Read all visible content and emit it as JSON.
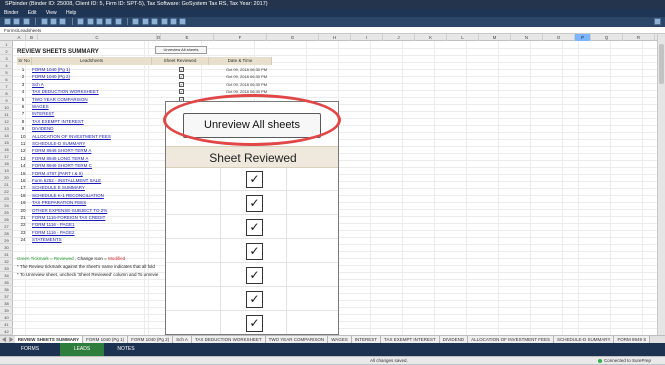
{
  "window": {
    "title": "SPbinder (Binder ID: 25008, Client ID: 5, Firm ID: SPT-5), Tax Software: GoSystem Tax RS, Tax Year: 2017)"
  },
  "menu": [
    "Binder",
    "Edit",
    "View",
    "Help"
  ],
  "breadcrumb": "Forms\\Leadsheets",
  "columns": [
    "A",
    "B",
    "C",
    "D",
    "E",
    "F",
    "G",
    "H",
    "I",
    "J",
    "K",
    "L",
    "M",
    "N",
    "O",
    "P",
    "Q",
    "R",
    "S",
    "T"
  ],
  "active_column": "P",
  "row_numbers": [
    "1",
    "2",
    "3",
    "4",
    "5",
    "6",
    "7",
    "8",
    "9",
    "10",
    "11",
    "12",
    "13",
    "14",
    "15",
    "16",
    "17",
    "18",
    "19",
    "20",
    "21",
    "22",
    "23",
    "24",
    "25",
    "26",
    "27",
    "28",
    "29",
    "30",
    "31",
    "32",
    "33",
    "34",
    "35",
    "36",
    "37",
    "38",
    "39",
    "40",
    "41",
    "42"
  ],
  "sheet": {
    "title": "REVIEW SHEETS SUMMARY",
    "headers": {
      "srno": "Sr No",
      "leadsheets": "Leadsheets",
      "reviewed": "Sheet Reviewed",
      "datetime": "Date & Time"
    },
    "unreview_button": "Unreview All sheets",
    "rows": [
      {
        "no": "1",
        "name": "FORM 1040 (Pg 1)",
        "checked": true,
        "date": "Oct 09, 2018 06:30 PM"
      },
      {
        "no": "2",
        "name": "FORM 1040 (Pg 2)",
        "checked": true,
        "date": "Oct 09, 2018 06:30 PM"
      },
      {
        "no": "3",
        "name": "Sch A",
        "checked": true,
        "date": "Oct 09, 2018 06:30 PM"
      },
      {
        "no": "4",
        "name": "TAX DEDUCTION WORKSHEET",
        "checked": true,
        "date": "Oct 09, 2018 06:30 PM"
      },
      {
        "no": "5",
        "name": "TWO YEAR COMPARISON",
        "checked": true,
        "date": ""
      },
      {
        "no": "6",
        "name": "WAGES",
        "checked": true,
        "date": ""
      },
      {
        "no": "7",
        "name": "INTEREST",
        "checked": false,
        "date": ""
      },
      {
        "no": "8",
        "name": "TAX EXEMPT INTEREST",
        "checked": false,
        "date": ""
      },
      {
        "no": "9",
        "name": "DIVIDEND",
        "checked": false,
        "date": ""
      },
      {
        "no": "10",
        "name": "ALLOCATION OF INVESTMENT FEES",
        "checked": false,
        "date": ""
      },
      {
        "no": "11",
        "name": "SCHEDULE-D SUMMARY",
        "checked": false,
        "date": ""
      },
      {
        "no": "12",
        "name": "FORM 8949 SHORT-TERM A",
        "checked": false,
        "date": ""
      },
      {
        "no": "13",
        "name": "FORM 8949 LONG TERM A",
        "checked": false,
        "date": ""
      },
      {
        "no": "14",
        "name": "FORM 8949 SHORT-TERM C",
        "checked": false,
        "date": ""
      },
      {
        "no": "15",
        "name": "FORM 4797 (PART I & II)",
        "checked": false,
        "date": ""
      },
      {
        "no": "16",
        "name": "Form 6252 - INSTALLMENT SALE",
        "checked": false,
        "date": ""
      },
      {
        "no": "17",
        "name": "SCHEDULE E SUMMARY",
        "checked": false,
        "date": ""
      },
      {
        "no": "18",
        "name": "SCHEDULE K-1 RECONCILIATION",
        "checked": false,
        "date": ""
      },
      {
        "no": "19",
        "name": "TAX PREPARATION FEES",
        "checked": false,
        "date": ""
      },
      {
        "no": "20",
        "name": "OTHER EXPENSE-SUBJECT TO 2%",
        "checked": false,
        "date": ""
      },
      {
        "no": "21",
        "name": "FORM 1116-FOREIGN TAX CREDIT",
        "checked": false,
        "date": ""
      },
      {
        "no": "22",
        "name": "FORM 1116 - PAGE1",
        "checked": false,
        "date": ""
      },
      {
        "no": "23",
        "name": "FORM 1116 - PAGE2",
        "checked": false,
        "date": ""
      },
      {
        "no": "24",
        "name": "STATEMENTS",
        "checked": false,
        "date": ""
      }
    ],
    "legend": {
      "prefix": "Green Tickmark = ",
      "reviewed": "Reviewed",
      "mid": " , Change Icon = ",
      "modified": "Modified"
    },
    "note1": "* The Review tickmark against the sheet's name indicates that all fold",
    "note2": "* To Unreview sheet, uncheck 'Sheet Reviewed' column and  To unrevie"
  },
  "zoom": {
    "button": "Unreview All sheets",
    "header": "Sheet Reviewed",
    "check_glyph": "✓",
    "checks": [
      true,
      true,
      true,
      true,
      true,
      true,
      true
    ]
  },
  "tabs": [
    "REVIEW SHEETS SUMMARY",
    "FORM 1040 (Pg 1)",
    "FORM 1040 (Pg 2)",
    "Sch A",
    "TAX DEDUCTION WORKSHEET",
    "TWO YEAR COMPARISON",
    "WAGES",
    "INTEREST",
    "TAX EXEMPT INTEREST",
    "DIVIDEND",
    "ALLOCATION OF INVESTMENT FEES",
    "SCHEDULE-D SUMMARY",
    "FORM 8949 S"
  ],
  "mode_tabs": [
    "FORMS",
    "LEADS",
    "NOTES"
  ],
  "active_mode": "LEADS",
  "status": {
    "center": "All changes saved.",
    "connection": "Connected to SurePrep"
  },
  "colors": {
    "accent_green": "#2e7d3c",
    "title_navy": "#24344d",
    "link_blue": "#1b1bb3",
    "highlight_red": "#e04848"
  }
}
